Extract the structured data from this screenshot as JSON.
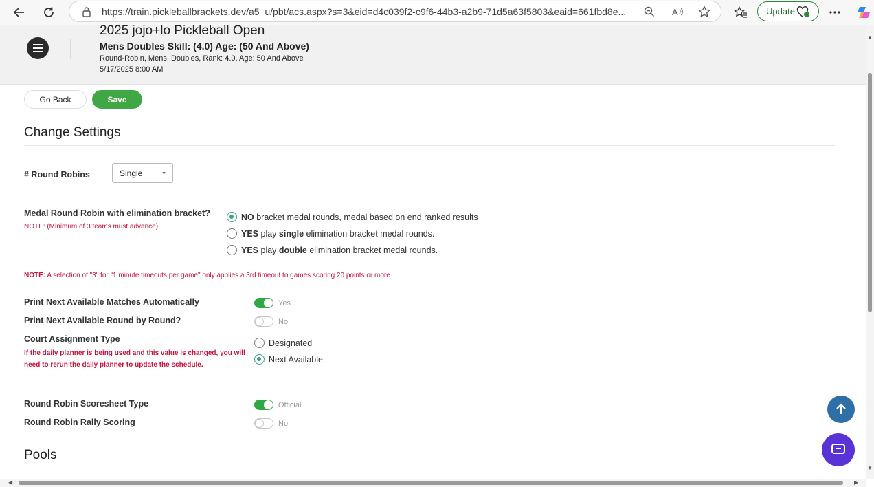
{
  "browser": {
    "url": "https://train.pickleballbrackets.dev/a5_u/pbt/acs.aspx?s=3&eid=d4c039f2-c9f6-44b3-a2b9-71d5a63f5803&eaid=661fbd8e...",
    "update_label": "Update"
  },
  "header": {
    "title": "2025 jojo+lo Pickleball Open",
    "subtitle": "Mens Doubles Skill: (4.0) Age: (50 And Above)",
    "detail": "Round-Robin, Mens, Doubles, Rank: 4.0, Age: 50 And Above",
    "datetime": "5/17/2025 8:00 AM"
  },
  "actions": {
    "go_back": "Go Back",
    "save": "Save"
  },
  "settings": {
    "title": "Change Settings",
    "round_robins": {
      "label": "# Round Robins",
      "selected": "Single"
    },
    "medal": {
      "label": "Medal Round Robin with elimination bracket?",
      "note": "NOTE: (Minimum of 3 teams must advance)",
      "options": [
        {
          "lead": "NO",
          "mid": "",
          "rest": " bracket medal rounds, medal based on end ranked results",
          "selected": true
        },
        {
          "lead": "YES",
          "mid_pre": " play ",
          "mid": "single",
          "rest": " elimination bracket medal rounds.",
          "selected": false
        },
        {
          "lead": "YES",
          "mid_pre": " play ",
          "mid": "double",
          "rest": " elimination bracket medal rounds.",
          "selected": false
        }
      ]
    },
    "timeout_note_prefix": "NOTE:",
    "timeout_note": " A selection of \"3\" for \"1 minute timeouts per game\" only applies a 3rd timeout to games scoring 20 points or more.",
    "print_auto": {
      "label": "Print Next Available Matches Automatically",
      "value": "Yes",
      "on": true
    },
    "print_round": {
      "label": "Print Next Available Round by Round?",
      "value": "No",
      "on": false
    },
    "court": {
      "label": "Court Assignment Type",
      "note": "If the daily planner is being used and this value is changed, you will need to rerun the daily planner to update the schedule.",
      "options": [
        {
          "label": "Designated",
          "selected": false
        },
        {
          "label": "Next Available",
          "selected": true
        }
      ]
    },
    "scoresheet": {
      "label": "Round Robin Scoresheet Type",
      "value": "Official",
      "on": true
    },
    "rally": {
      "label": "Round Robin Rally Scoring",
      "value": "No",
      "on": false
    }
  },
  "pools": {
    "title": "Pools"
  },
  "colors": {
    "save_green": "#3fa845",
    "note_red": "#c8143c",
    "toggle_on": "#2fa845",
    "fab_blue": "#2d6fa6",
    "chat_purple": "#5a33d6"
  },
  "icons": [
    "back-arrow-icon",
    "reload-icon",
    "lock-icon",
    "zoom-icon",
    "read-aloud-icon",
    "star-icon",
    "favorites-icon",
    "more-icon",
    "copilot-icon",
    "hamburger-icon",
    "arrow-up-icon",
    "chat-icon"
  ]
}
